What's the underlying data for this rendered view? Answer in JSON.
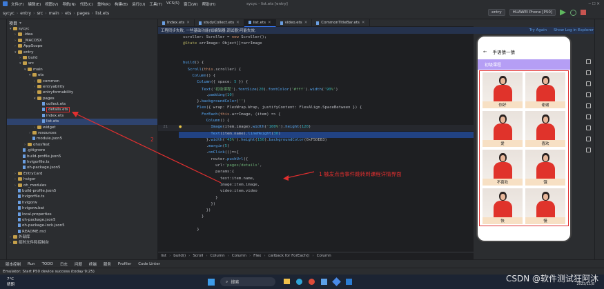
{
  "menu": {
    "items": [
      "文件(F)",
      "编辑(E)",
      "视图(V)",
      "导航(N)",
      "代码(C)",
      "重构(R)",
      "构建(B)",
      "运行(U)",
      "工具(T)",
      "VCS(S)",
      "窗口(W)",
      "帮助(H)"
    ],
    "window_title": "sycyc - list.ets [entry]"
  },
  "toolbar": {
    "breadcrumbs": [
      "sycyc",
      "entry",
      "src",
      "main",
      "ets",
      "pages",
      "list.ets"
    ],
    "run_config": "entry",
    "device": "HUAWEI Phone [P50]"
  },
  "project": {
    "header": "项目",
    "tree": [
      {
        "label": "sycyc",
        "depth": 0,
        "type": "folder",
        "open": true
      },
      {
        "label": ".idea",
        "depth": 1,
        "type": "folder"
      },
      {
        "label": "_MACOSX",
        "depth": 1,
        "type": "folder"
      },
      {
        "label": "AppScope",
        "depth": 1,
        "type": "folder"
      },
      {
        "label": "entry",
        "depth": 1,
        "type": "folder",
        "open": true
      },
      {
        "label": "build",
        "depth": 2,
        "type": "folder"
      },
      {
        "label": "src",
        "depth": 2,
        "type": "folder",
        "open": true
      },
      {
        "label": "main",
        "depth": 3,
        "type": "folder",
        "open": true
      },
      {
        "label": "ets",
        "depth": 4,
        "type": "folder",
        "open": true
      },
      {
        "label": "common",
        "depth": 5,
        "type": "folder"
      },
      {
        "label": "entryability",
        "depth": 5,
        "type": "folder"
      },
      {
        "label": "entryformability",
        "depth": 5,
        "type": "folder"
      },
      {
        "label": "pages",
        "depth": 5,
        "type": "folder",
        "open": true
      },
      {
        "label": "collect.ets",
        "depth": 6,
        "type": "file"
      },
      {
        "label": "details.ets",
        "depth": 6,
        "type": "file",
        "boxed": true
      },
      {
        "label": "index.ets",
        "depth": 6,
        "type": "file"
      },
      {
        "label": "list.ets",
        "depth": 6,
        "type": "file",
        "selected": true
      },
      {
        "label": "widget",
        "depth": 5,
        "type": "folder"
      },
      {
        "label": "resources",
        "depth": 4,
        "type": "folder"
      },
      {
        "label": "module.json5",
        "depth": 4,
        "type": "file"
      },
      {
        "label": "ohosTest",
        "depth": 3,
        "type": "folder"
      },
      {
        "label": ".gitignore",
        "depth": 2,
        "type": "file"
      },
      {
        "label": "build-profile.json5",
        "depth": 2,
        "type": "file"
      },
      {
        "label": "hvigorfile.ts",
        "depth": 2,
        "type": "file"
      },
      {
        "label": "oh-package.json5",
        "depth": 2,
        "type": "file"
      },
      {
        "label": "EntryCard",
        "depth": 1,
        "type": "folder"
      },
      {
        "label": "hvigor",
        "depth": 1,
        "type": "folder"
      },
      {
        "label": "oh_modules",
        "depth": 1,
        "type": "folder"
      },
      {
        "label": "build-profile.json5",
        "depth": 1,
        "type": "file"
      },
      {
        "label": "hvigorfile.ts",
        "depth": 1,
        "type": "file"
      },
      {
        "label": "hvigorw",
        "depth": 1,
        "type": "file"
      },
      {
        "label": "hvigorw.bat",
        "depth": 1,
        "type": "file"
      },
      {
        "label": "local.properties",
        "depth": 1,
        "type": "file"
      },
      {
        "label": "oh-package.json5",
        "depth": 1,
        "type": "file"
      },
      {
        "label": "oh-package-lock.json5",
        "depth": 1,
        "type": "file"
      },
      {
        "label": "README.md",
        "depth": 1,
        "type": "file"
      },
      {
        "label": "外部库",
        "depth": 0,
        "type": "folder"
      },
      {
        "label": "临时文件和控制台",
        "depth": 0,
        "type": "folder"
      }
    ]
  },
  "tabs": [
    {
      "label": "Index.ets",
      "active": false
    },
    {
      "label": "studyCollect.ets",
      "active": false
    },
    {
      "label": "list.ets",
      "active": true
    },
    {
      "label": "video.ets",
      "active": false
    },
    {
      "label": "CommonTitleBar.ets",
      "active": false
    }
  ],
  "banner": {
    "text": "工程同步失败, 一些基础功能(如编辑器,调试器)可能失效.",
    "try_again": "Try Again",
    "show_log": "Show Log in Explorer"
  },
  "editor": {
    "lines": [
      {
        "n": "",
        "t": "scroller: Scroller = new Scroller();"
      },
      {
        "n": "",
        "t": "@State arrImage: Object[]=arrImage"
      },
      {
        "n": "",
        "t": ""
      },
      {
        "n": "",
        "t": ""
      },
      {
        "n": "",
        "t": "build() {"
      },
      {
        "n": "",
        "t": "  Scroll(this.scroller) {"
      },
      {
        "n": "",
        "t": "    Column() {"
      },
      {
        "n": "",
        "t": "      Column({ space: 5 }) {"
      },
      {
        "n": "",
        "t": "        Text('初级课程').fontSize(20).fontColor('#fff').width('90%')"
      },
      {
        "n": "",
        "t": "          .padding(10)"
      },
      {
        "n": "",
        "t": "      }.backgroundColor('')"
      },
      {
        "n": "",
        "t": "      Flex({ wrap: FlexWrap.Wrap, justifyContent: FlexAlign.SpaceBetween }) {"
      },
      {
        "n": "",
        "t": "        ForEach(this.arrImage, (item) => {"
      },
      {
        "n": "",
        "t": "          Column() {"
      },
      {
        "n": "21",
        "t": "            Image(item.image).width('100%').height(120)"
      },
      {
        "n": "",
        "t": "            Text(item.name).lineHeight(30)"
      },
      {
        "n": "",
        "t": "          }.width('45%').height(150).backgroundColor(0xF5DEB3)"
      },
      {
        "n": "",
        "t": "          .margin(5)"
      },
      {
        "n": "",
        "t": "          .onClick(()=>{"
      },
      {
        "n": "",
        "t": "            router.pushUrl({"
      },
      {
        "n": "",
        "t": "              url:'pages/details',"
      },
      {
        "n": "",
        "t": "              params:{"
      },
      {
        "n": "",
        "t": "                text:item.name,"
      },
      {
        "n": "",
        "t": "                image:item.image,"
      },
      {
        "n": "",
        "t": "                video:item.video"
      },
      {
        "n": "",
        "t": "              }"
      },
      {
        "n": "",
        "t": "            })"
      },
      {
        "n": "",
        "t": "          })"
      },
      {
        "n": "",
        "t": "        }"
      },
      {
        "n": "",
        "t": ""
      },
      {
        "n": "",
        "t": "      }"
      }
    ]
  },
  "editor_crumbs": [
    "list",
    "build()",
    "Scroll",
    "Column",
    "Column",
    "Flex",
    "callback for ForEach()",
    "Column"
  ],
  "annotations": {
    "note1": "1  触发点击事件跳转到课程详情界面",
    "note2": "2"
  },
  "phone": {
    "title": "手语猜一猜",
    "section": "初级课程",
    "cards": [
      "你好",
      "谢谢",
      "爱",
      "喜欢",
      "不喜欢",
      "饿",
      "快",
      "慢"
    ]
  },
  "bottombar": {
    "items": [
      "版本控制",
      "Run",
      "TODO",
      "日志",
      "问题",
      "终端",
      "服务",
      "Profiler",
      "Code Linter"
    ]
  },
  "status": {
    "text": "Emulator: Start P50 device success (today 9:25)"
  },
  "taskbar": {
    "weather_temp": "7°C",
    "weather_text": "晴朗",
    "search": "搜索",
    "date": "2023/11/8"
  },
  "watermark": "CSDN @软件测试狂阿沐",
  "colors": {
    "accent": "#3574f0",
    "phone_bar": "#b59ef5",
    "annotation_red": "#e02f2f"
  }
}
